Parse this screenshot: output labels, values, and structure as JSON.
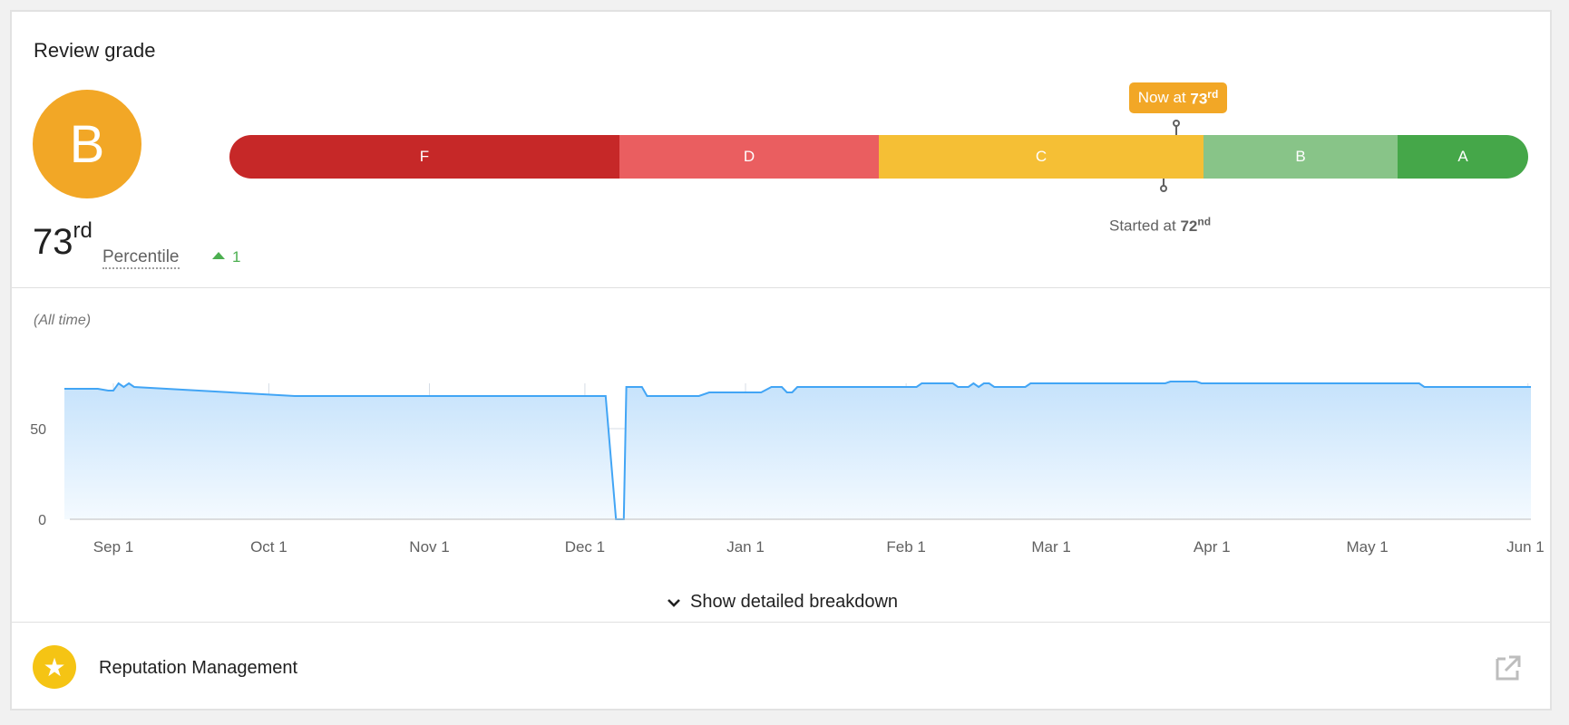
{
  "header": {
    "title": "Review grade"
  },
  "grade": {
    "letter": "B",
    "color": "#f2a726"
  },
  "percentile": {
    "value": "73",
    "suffix": "rd",
    "label": "Percentile",
    "change": "1",
    "change_direction": "up",
    "change_color": "#4caf50"
  },
  "scale": {
    "segments": [
      {
        "label": "F",
        "color": "#c62828"
      },
      {
        "label": "D",
        "color": "#ea5e60"
      },
      {
        "label": "C",
        "color": "#f5bf35"
      },
      {
        "label": "B",
        "color": "#88c488"
      },
      {
        "label": "A",
        "color": "#45a749"
      }
    ],
    "now_prefix": "Now at ",
    "now_value": "73",
    "now_suffix": "rd",
    "started_prefix": "Started at ",
    "started_value": "72",
    "started_suffix": "nd"
  },
  "chart_data": {
    "type": "area",
    "range_label": "(All time)",
    "ylim": [
      0,
      75
    ],
    "y_ticks": [
      "0",
      "50"
    ],
    "x_ticks": [
      "Sep 1",
      "Oct 1",
      "Nov 1",
      "Dec 1",
      "Jan 1",
      "Feb 1",
      "Mar 1",
      "Apr 1",
      "May 1",
      "Jun 1"
    ],
    "line_color": "#42a5f5",
    "series": [
      {
        "values": [
          [
            -10,
            72
          ],
          [
            -3,
            72
          ],
          [
            -1,
            71
          ],
          [
            0,
            71
          ],
          [
            1,
            75
          ],
          [
            2,
            73
          ],
          [
            3,
            75
          ],
          [
            4,
            73
          ],
          [
            35,
            68
          ],
          [
            95,
            68
          ],
          [
            97,
            0
          ],
          [
            98.5,
            0
          ],
          [
            99,
            73
          ],
          [
            102,
            73
          ],
          [
            103,
            68
          ],
          [
            113,
            68
          ],
          [
            115,
            70
          ],
          [
            125,
            70
          ],
          [
            127,
            73
          ],
          [
            129,
            73
          ],
          [
            130,
            70
          ],
          [
            131,
            70
          ],
          [
            132,
            73
          ],
          [
            155,
            73
          ],
          [
            156,
            75
          ],
          [
            162,
            75
          ],
          [
            163,
            73
          ],
          [
            165,
            73
          ],
          [
            166,
            75
          ],
          [
            167,
            73
          ],
          [
            168,
            75
          ],
          [
            169,
            75
          ],
          [
            170,
            73
          ],
          [
            176,
            73
          ],
          [
            177,
            75
          ],
          [
            203,
            75
          ],
          [
            204,
            76
          ],
          [
            209,
            76
          ],
          [
            210,
            75
          ],
          [
            252,
            75
          ],
          [
            253,
            73
          ],
          [
            275,
            73
          ]
        ]
      }
    ]
  },
  "breakdown": {
    "label": "Show detailed breakdown"
  },
  "footer": {
    "label": "Reputation Management"
  }
}
